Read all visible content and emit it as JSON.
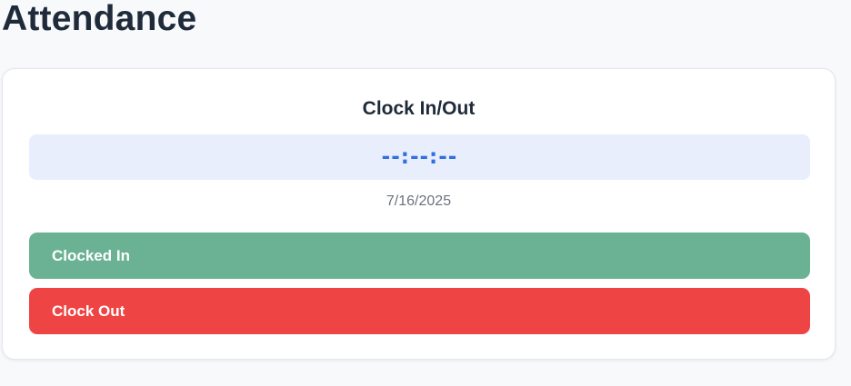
{
  "page": {
    "title": "Attendance"
  },
  "card": {
    "title": "Clock In/Out",
    "time_display": "--:--:--",
    "date": "7/16/2025",
    "clocked_in_label": "Clocked In",
    "clock_out_label": "Clock Out"
  },
  "colors": {
    "background": "#f8f9fb",
    "time_box_bg": "#e8eefc",
    "time_text": "#2f6fe0",
    "clocked_in_bg": "#6bb193",
    "clock_out_bg": "#ef4444"
  }
}
